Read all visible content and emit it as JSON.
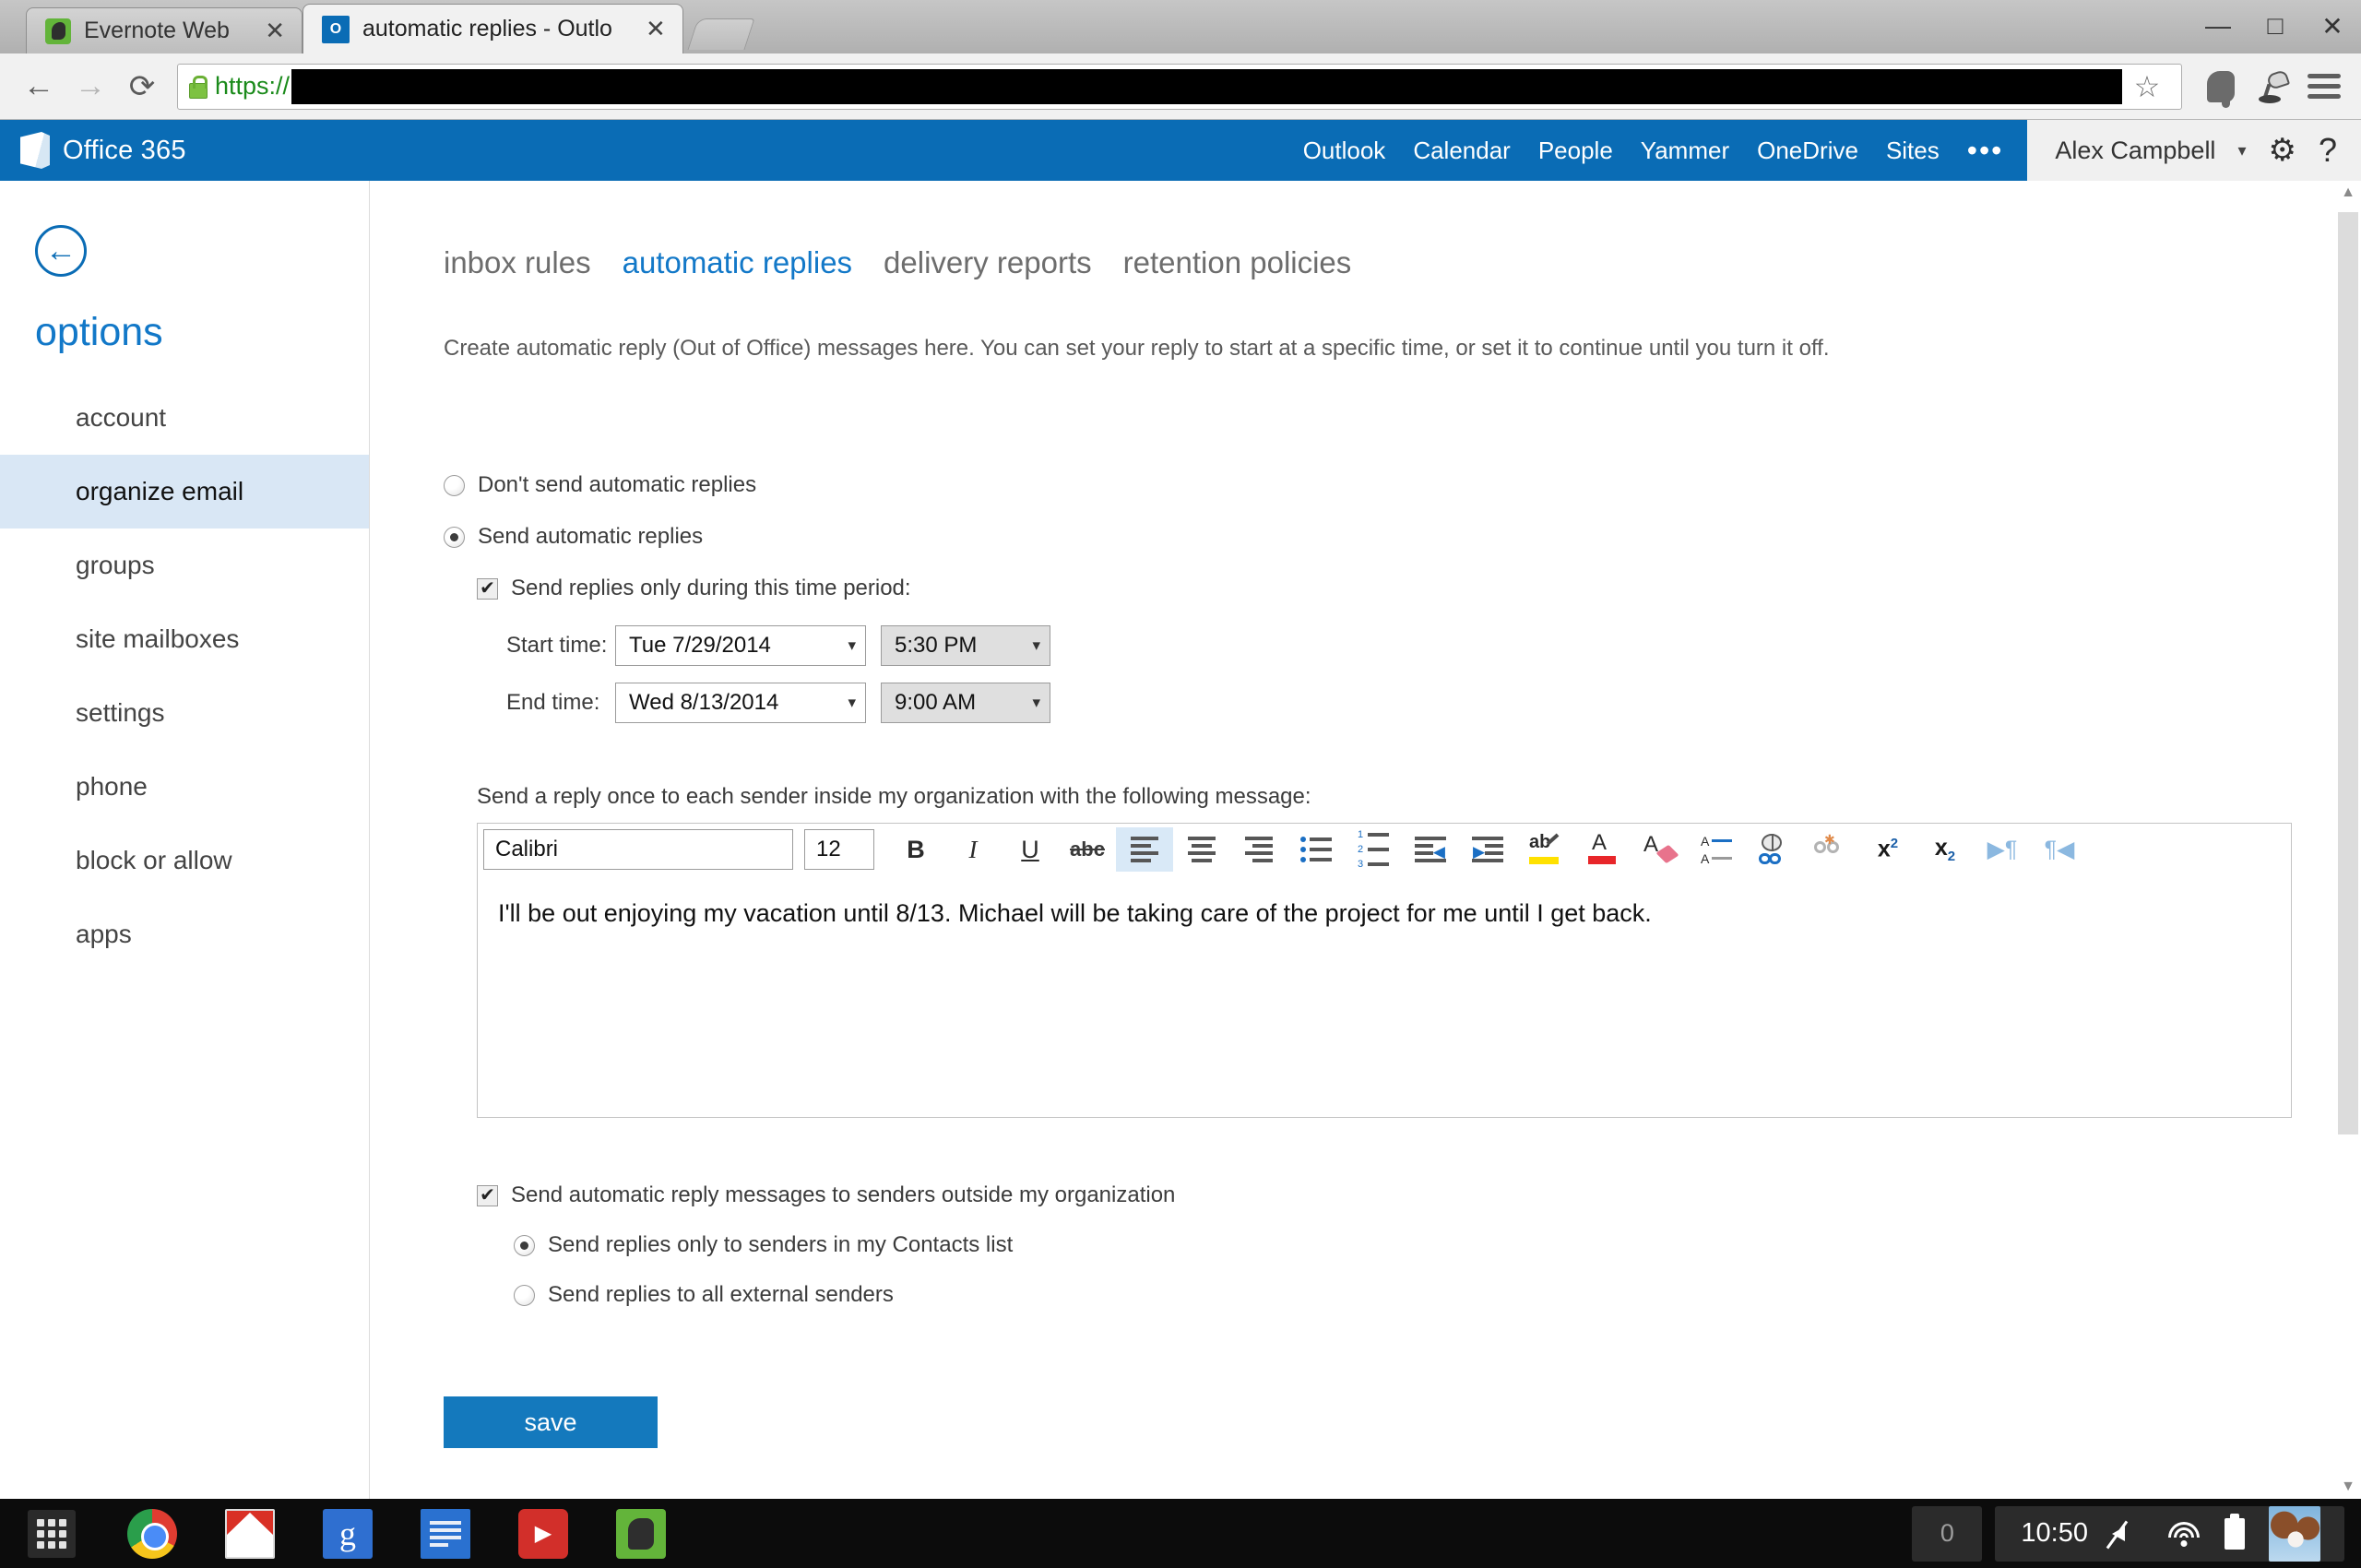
{
  "browser": {
    "tabs": [
      {
        "title": "Evernote Web",
        "icon": "evernote-icon",
        "close_label": "✕",
        "active": false
      },
      {
        "title": "automatic replies - Outlo",
        "icon": "outlook-icon",
        "close_label": "✕",
        "active": true
      }
    ],
    "new_tab_label": "+",
    "window_controls": {
      "minimize": "—",
      "maximize": "□",
      "close": "✕"
    },
    "nav": {
      "back": "←",
      "forward": "→",
      "reload": "⟳",
      "url_scheme": "https://",
      "url_redacted": true,
      "bookmark_star": "☆"
    },
    "extensions": [
      "evernote-clipper-icon",
      "desk-lamp-icon",
      "chrome-menu-icon"
    ]
  },
  "suitebar": {
    "brand": "Office 365",
    "nav_items": [
      "Outlook",
      "Calendar",
      "People",
      "Yammer",
      "OneDrive",
      "Sites"
    ],
    "overflow": "•••",
    "user_name": "Alex Campbell",
    "user_caret": "▾",
    "settings_icon": "⚙",
    "help_icon": "?",
    "accent_color": "#0a6cb5"
  },
  "sidebar": {
    "back_arrow": "←",
    "title": "options",
    "items": [
      {
        "label": "account",
        "selected": false
      },
      {
        "label": "organize email",
        "selected": true
      },
      {
        "label": "groups",
        "selected": false
      },
      {
        "label": "site mailboxes",
        "selected": false
      },
      {
        "label": "settings",
        "selected": false
      },
      {
        "label": "phone",
        "selected": false
      },
      {
        "label": "block or allow",
        "selected": false
      },
      {
        "label": "apps",
        "selected": false
      }
    ]
  },
  "main": {
    "tabs": [
      {
        "label": "inbox rules",
        "active": false
      },
      {
        "label": "automatic replies",
        "active": true
      },
      {
        "label": "delivery reports",
        "active": false
      },
      {
        "label": "retention policies",
        "active": false
      }
    ],
    "description": "Create automatic reply (Out of Office) messages here. You can set your reply to start at a specific time, or set it to continue until you turn it off.",
    "option_dont_send": {
      "label": "Don't send automatic replies",
      "checked": false
    },
    "option_send": {
      "label": "Send automatic replies",
      "checked": true
    },
    "time_period": {
      "checkbox_label": "Send replies only during this time period:",
      "checked": true,
      "checkmark": "✔",
      "start_label": "Start time:",
      "start_date": "Tue 7/29/2014",
      "start_time": "5:30 PM",
      "end_label": "End time:",
      "end_date": "Wed 8/13/2014",
      "end_time": "9:00 AM",
      "caret": "▾"
    },
    "message_label": "Send a reply once to each sender inside my organization with the following message:",
    "editor": {
      "font_name": "Calibri",
      "font_size": "12",
      "body_text": "I'll be out enjoying my vacation until 8/13. Michael will be taking care of the project for me until I get back.",
      "toolbar": [
        {
          "name": "bold-button",
          "glyph": "B"
        },
        {
          "name": "italic-button",
          "glyph": "I"
        },
        {
          "name": "underline-button",
          "glyph": "U"
        },
        {
          "name": "strikethrough-button",
          "glyph": "abc"
        },
        {
          "name": "align-left-button",
          "glyph": ""
        },
        {
          "name": "align-center-button",
          "glyph": ""
        },
        {
          "name": "align-right-button",
          "glyph": ""
        },
        {
          "name": "bulleted-list-button",
          "glyph": ""
        },
        {
          "name": "numbered-list-button",
          "glyph": ""
        },
        {
          "name": "decrease-indent-button",
          "glyph": ""
        },
        {
          "name": "increase-indent-button",
          "glyph": ""
        },
        {
          "name": "highlight-button",
          "glyph": ""
        },
        {
          "name": "font-color-button",
          "glyph": ""
        },
        {
          "name": "clear-formatting-button",
          "glyph": ""
        },
        {
          "name": "line-spacing-button",
          "glyph": ""
        },
        {
          "name": "insert-link-button",
          "glyph": ""
        },
        {
          "name": "remove-link-button",
          "glyph": ""
        },
        {
          "name": "superscript-button",
          "glyph": "x"
        },
        {
          "name": "subscript-button",
          "glyph": "x"
        },
        {
          "name": "ltr-direction-button",
          "glyph": "¶"
        },
        {
          "name": "rtl-direction-button",
          "glyph": "¶"
        }
      ]
    },
    "external": {
      "checkbox_label": "Send automatic reply messages to senders outside my organization",
      "checked": true,
      "checkmark": "✔",
      "option_contacts": {
        "label": "Send replies only to senders in my Contacts list",
        "checked": true
      },
      "option_all": {
        "label": "Send replies to all external senders",
        "checked": false
      }
    },
    "save_label": "save",
    "save_color": "#1479bd"
  },
  "taskbar": {
    "launcher_name": "app-launcher",
    "apps": [
      "chrome-icon",
      "gmail-icon",
      "google-search-icon",
      "google-docs-icon",
      "youtube-icon",
      "evernote-icon"
    ],
    "gplus_glyph": "g",
    "youtube_glyph": "▶",
    "notification_count": "0",
    "clock": "10:50",
    "status_icons": [
      "mute-icon",
      "wifi-icon",
      "battery-icon"
    ],
    "avatar_name": "user-avatar"
  }
}
